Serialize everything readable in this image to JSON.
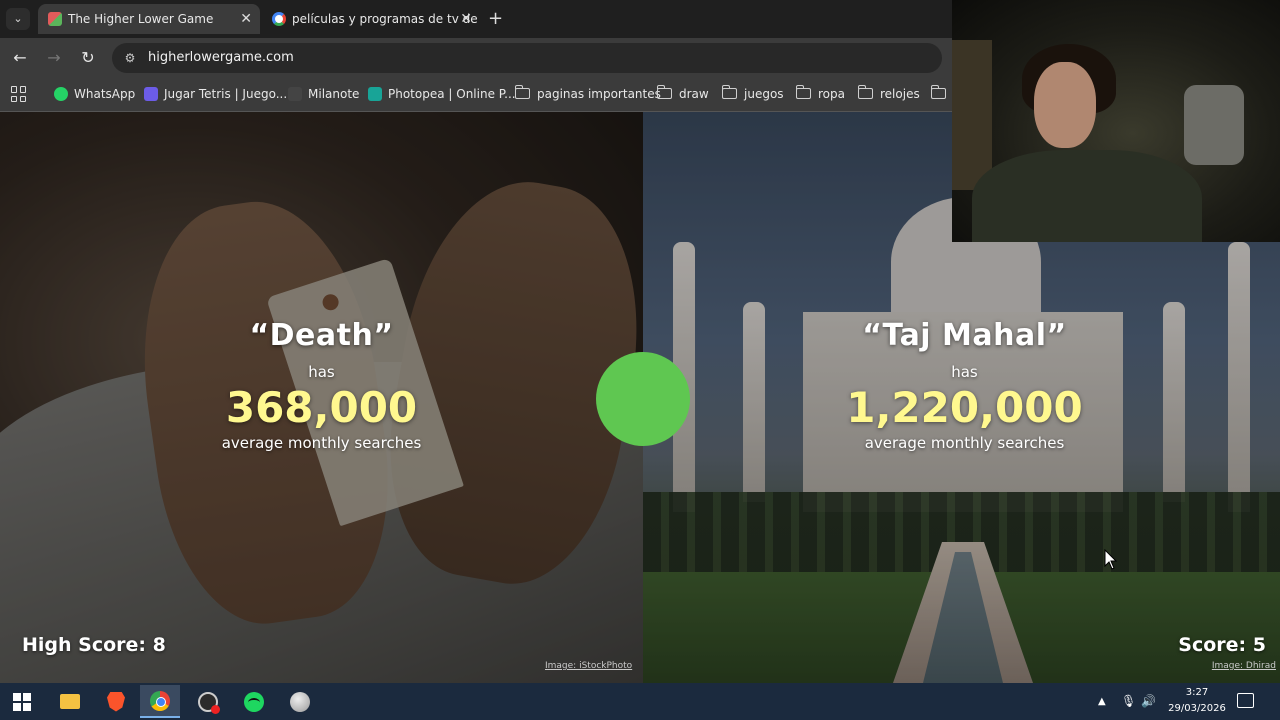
{
  "browser": {
    "tabs": [
      {
        "title": "The Higher Lower Game",
        "active": true,
        "favicon": "higherlower-favicon-icon"
      },
      {
        "title": "películas y programas de tv de",
        "active": false,
        "favicon": "google-favicon-icon"
      }
    ],
    "new_tab_glyph": "+",
    "tab_menu_glyph": "⌄",
    "url": "higherlowergame.com",
    "bookmarks": [
      {
        "label": "WhatsApp",
        "icon": "whatsapp-icon",
        "color": "#25d366"
      },
      {
        "label": "Jugar Tetris | Juego...",
        "icon": "tetris-icon",
        "color": "#6c5ce7"
      },
      {
        "label": "Milanote",
        "icon": "milanote-icon",
        "color": "#444444"
      },
      {
        "label": "Photopea | Online P...",
        "icon": "photopea-icon",
        "color": "#18a497"
      },
      {
        "label": "paginas importantes",
        "icon": "folder-icon"
      },
      {
        "label": "draw",
        "icon": "folder-icon"
      },
      {
        "label": "juegos",
        "icon": "folder-icon"
      },
      {
        "label": "ropa",
        "icon": "folder-icon"
      },
      {
        "label": "relojes",
        "icon": "folder-icon"
      }
    ]
  },
  "game": {
    "left": {
      "term": "“Death”",
      "has": "has",
      "count": "368,000",
      "label": "average monthly searches",
      "credit": "Image: iStockPhoto"
    },
    "right": {
      "term": "“Taj Mahal”",
      "has": "has",
      "count": "1,220,000",
      "label": "average monthly searches",
      "credit": "Image: Dhirad"
    },
    "high_score": "High Score: 8",
    "score": "Score: 5",
    "result_color": "#5fc751"
  },
  "taskbar": {
    "apps": [
      "windows-start-icon",
      "file-explorer-icon",
      "brave-icon",
      "chrome-icon",
      "obs-icon",
      "spotify-icon",
      "app-icon"
    ],
    "tray": {
      "time": "3:27",
      "date": "29/03/2026"
    }
  }
}
